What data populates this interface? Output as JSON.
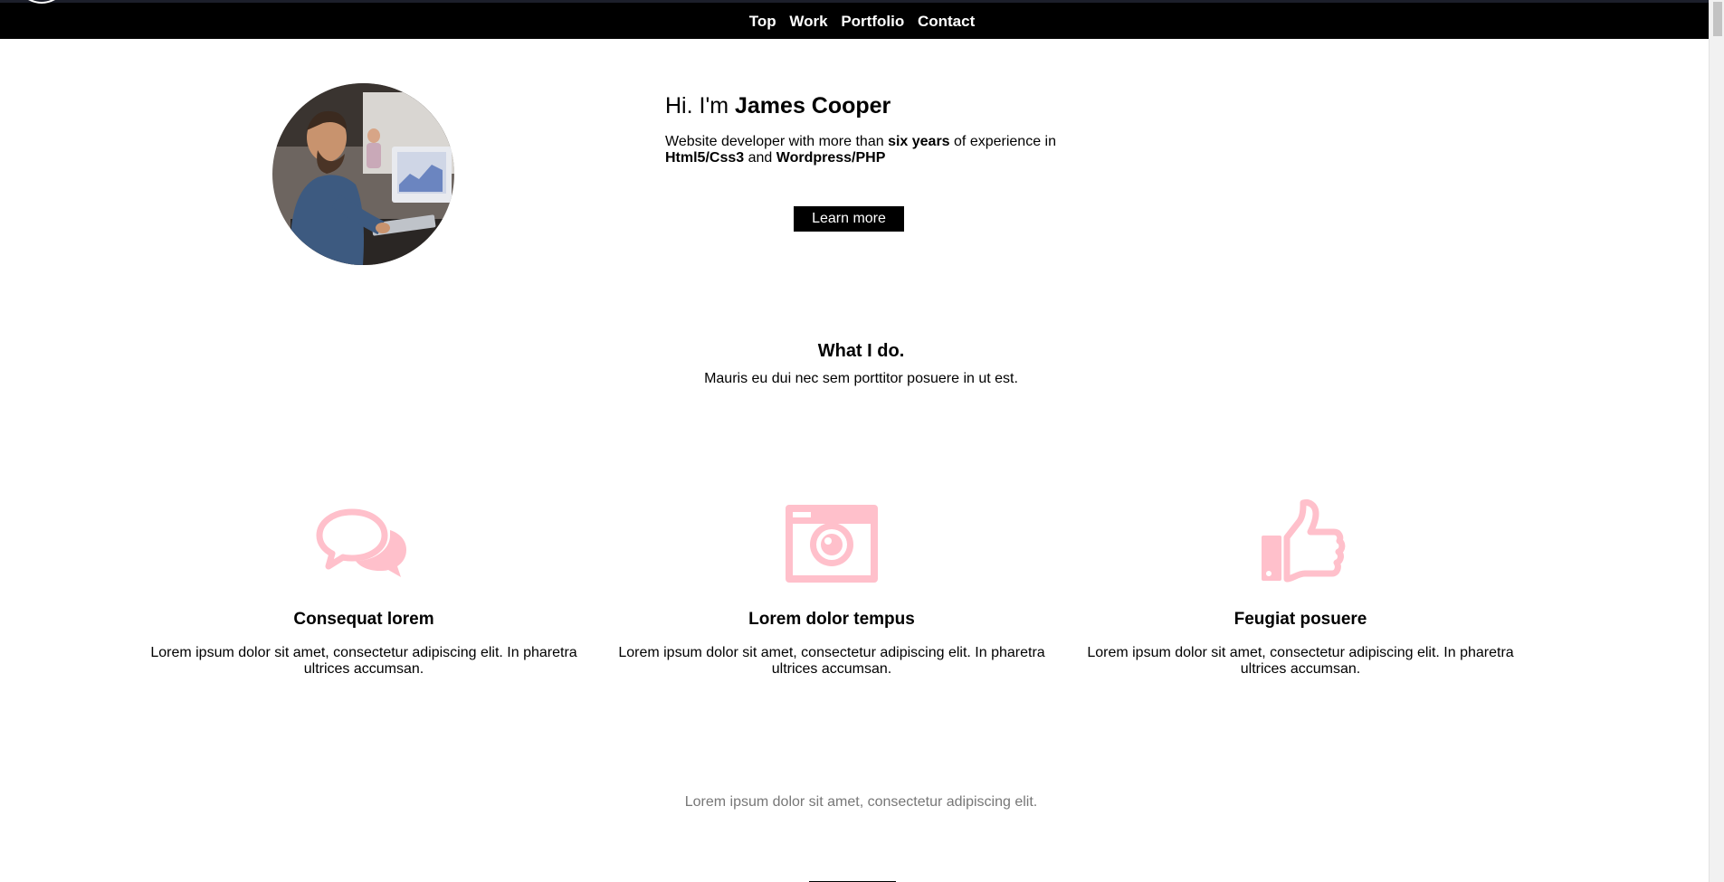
{
  "nav": {
    "links": [
      "Top",
      "Work",
      "Portfolio",
      "Contact"
    ]
  },
  "hero": {
    "greeting": "Hi. I'm ",
    "name": "James Cooper",
    "desc_1": "Website developer with more than ",
    "desc_bold_1": "six years",
    "desc_2": " of experience in ",
    "desc_bold_2": "Html5/Css3",
    "desc_3": " and ",
    "desc_bold_3": "Wordpress/PHP",
    "button_label": "Learn more"
  },
  "what_i_do": {
    "title": "What I do.",
    "subtitle": "Mauris eu dui nec sem porttitor posuere in ut est."
  },
  "features": [
    {
      "icon": "chat-bubbles-icon",
      "title": "Consequat lorem",
      "text": "Lorem ipsum dolor sit amet, consectetur adipiscing elit. In pharetra ultrices accumsan."
    },
    {
      "icon": "camera-icon",
      "title": "Lorem dolor tempus",
      "text": "Lorem ipsum dolor sit amet, consectetur adipiscing elit. In pharetra ultrices accumsan."
    },
    {
      "icon": "thumbs-up-icon",
      "title": "Feugiat posuere",
      "text": "Lorem ipsum dolor sit amet, consectetur adipiscing elit. In pharetra ultrices accumsan."
    }
  ],
  "footer": {
    "text": "Lorem ipsum dolor sit amet, consectetur adipiscing elit."
  },
  "colors": {
    "accent_icon": "#ffc0cb",
    "nav_bg": "#000000"
  }
}
